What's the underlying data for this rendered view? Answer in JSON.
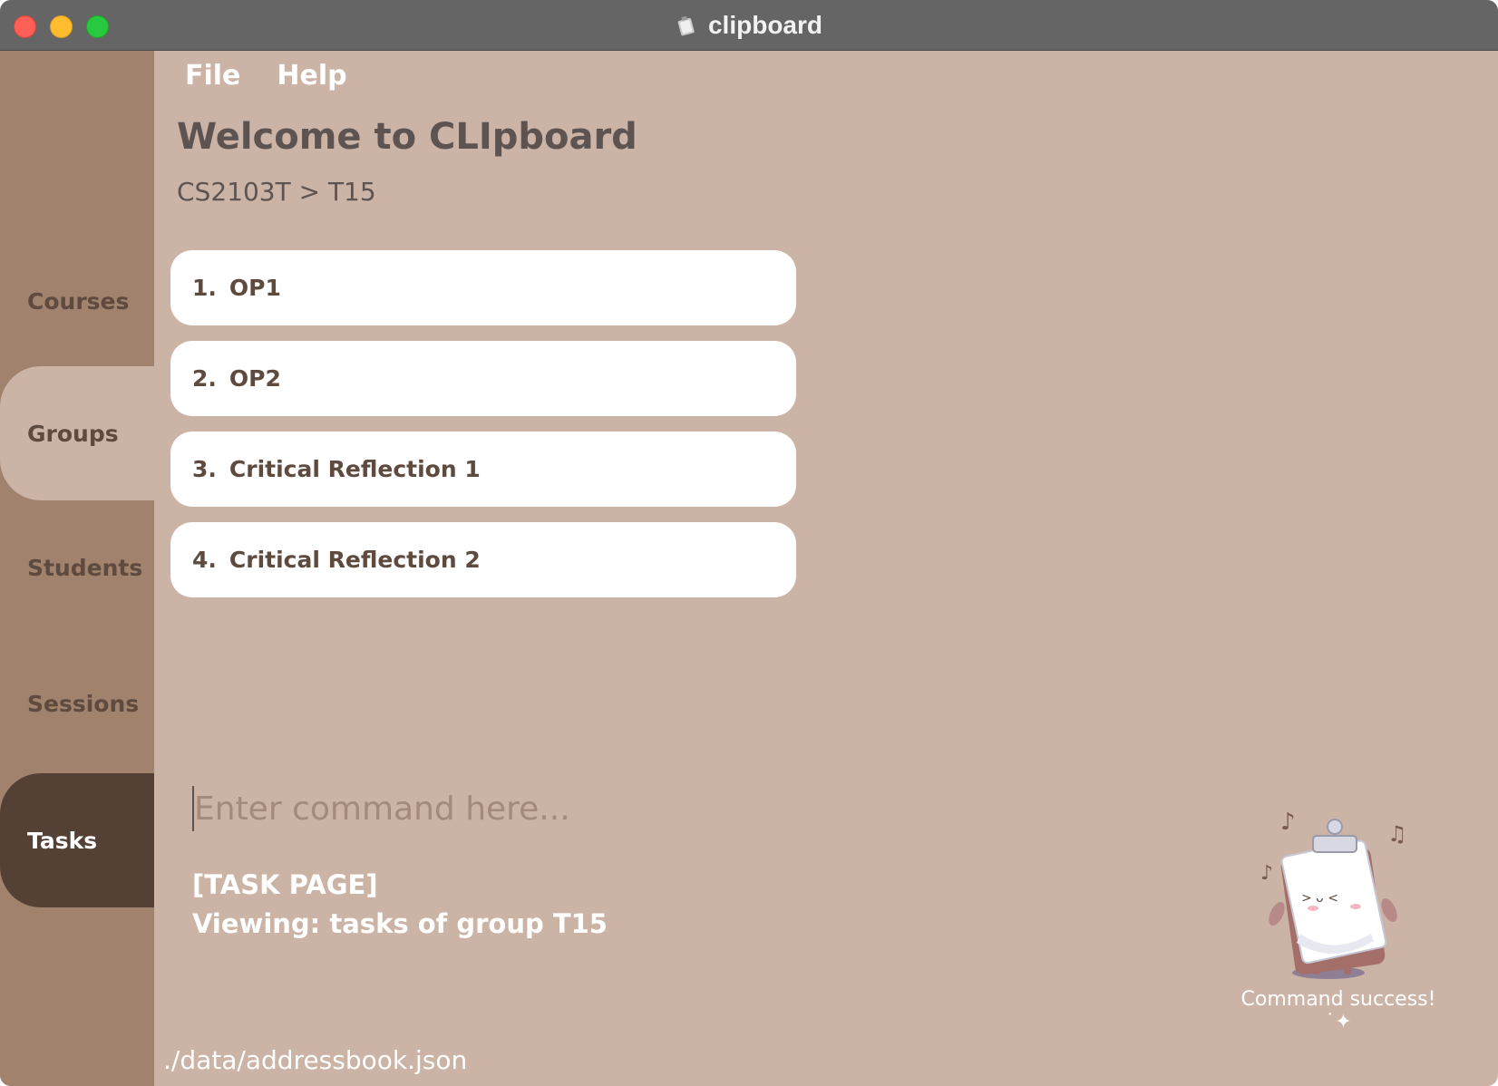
{
  "window": {
    "title": "clipboard",
    "app_icon": "clipboard-app-icon"
  },
  "sidebar": {
    "items": [
      {
        "label": "Courses"
      },
      {
        "label": "Groups"
      },
      {
        "label": "Students"
      },
      {
        "label": "Sessions"
      },
      {
        "label": "Tasks"
      }
    ]
  },
  "menu": {
    "items": [
      {
        "label": "File"
      },
      {
        "label": "Help"
      }
    ]
  },
  "main": {
    "welcome": "Welcome to CLIpboard",
    "breadcrumb": "CS2103T > T15",
    "tasks": [
      {
        "index": "1.",
        "name": "OP1"
      },
      {
        "index": "2.",
        "name": "OP2"
      },
      {
        "index": "3.",
        "name": "Critical Reflection 1"
      },
      {
        "index": "4.",
        "name": "Critical Reflection 2"
      }
    ]
  },
  "command": {
    "placeholder": "Enter command here...",
    "value": ""
  },
  "result": {
    "line1": "[TASK PAGE]",
    "line2": "Viewing: tasks of group T15"
  },
  "mascot": {
    "caption": "Command success!˙✦"
  },
  "status": {
    "path": "./data/addressbook.json"
  },
  "colors": {
    "background": "#cbb3a6",
    "sidebar": "#a0826d",
    "sidebar_active_dark": "#554036",
    "text_dark": "#5d5451",
    "card": "#ffffff"
  }
}
